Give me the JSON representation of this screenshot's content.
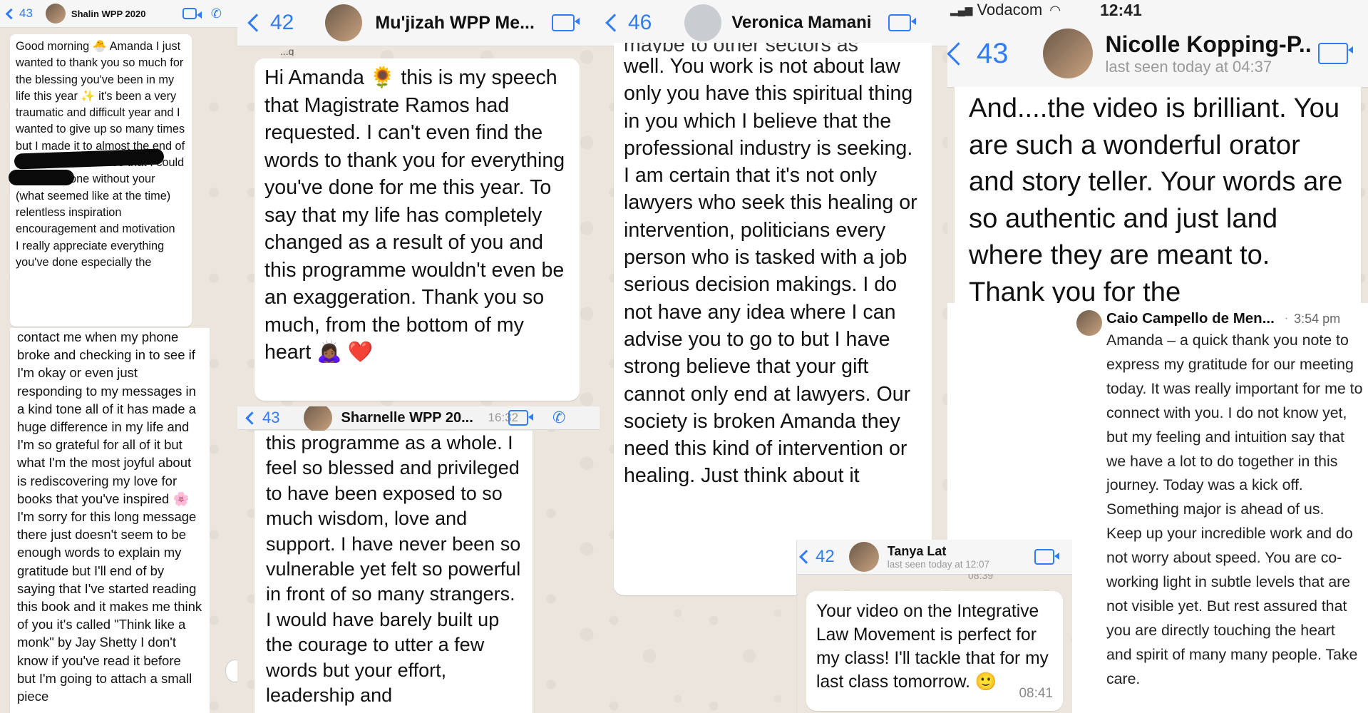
{
  "panel1": {
    "back_count": "43",
    "contact_name": "Shalin WPP 2020",
    "top_message": "Good morning 🐣 Amanda I just wanted to thank you so much for the blessing you've been in my life this year ✨ it's been a very traumatic and difficult year and I wanted to give up so many times\n                         but I made it to almost the end of the year and I realise that I could not have done without your (what seemed like at the time) relentless inspiration encouragement and motivation\nI really appreciate everything you've done especially the",
    "bottom_message": "contact me when my phone broke and checking in to see if I'm okay or even just responding to my messages in a kind tone all of it has made a huge difference in my life and I'm so grateful for all of it but what I'm the most joyful about is rediscovering my love for books that you've inspired 🌸 I'm sorry for this long message there just doesn't seem to be enough words to explain my gratitude but I'll end of by saying that I've started reading this book and it makes me think of you it's called \"Think like a monk\" by Jay Shetty I don't know if you've read it before but I'm going to attach a small piece"
  },
  "panel2": {
    "back_count": "42",
    "contact_name": "Mu'jizah WPP Me...",
    "top_fragment": "...g",
    "message": "Hi Amanda 🌻 this is my speech that Magistrate Ramos had requested. I can't even find the words to thank you for everything you've done for me this year. To say that my life has completely changed as a result of you and this programme wouldn't even be an exaggeration. Thank you so much, from the bottom of my heart 🙇🏾‍♀️ ❤️"
  },
  "panel3": {
    "back_count": "43",
    "contact_name": "Sharnelle WPP 20...",
    "time_fragment": "16:32",
    "message": "this programme as a whole. I feel so blessed and privileged to have been exposed to so much wisdom, love and support. I have never been so vulnerable yet felt so powerful in front of so many strangers. I would have barely built up the courage to utter a few words but your effort, leadership and"
  },
  "panel4": {
    "back_count": "46",
    "contact_name": "Veronica Mamani",
    "top_fragment": "maybe to other sectors as",
    "message": "well. You work is not about law only you have this spiritual thing in you which I believe that the professional industry is seeking.  I am certain that it's not only lawyers who seek this healing or intervention, politicians every person who is tasked with a job serious decision makings. I do not have any idea where I can advise you to go to but I have strong believe that your gift cannot only end at lawyers. Our society is broken Amanda they need this kind of intervention or healing. Just think about it"
  },
  "panel5": {
    "back_count": "42",
    "contact_name": "Tanya Lat",
    "last_seen": "last seen today at 12:07",
    "time_fragment": "08:39",
    "message": "Your video on the Integrative Law Movement is perfect for my class! I'll tackle that for my last class tomorrow. 🙂",
    "time": "08:41"
  },
  "panel6": {
    "carrier": "Vodacom",
    "clock": "12:41",
    "back_count": "43",
    "contact_name": "Nicolle Kopping-P...",
    "last_seen": "last seen today at 04:37",
    "message": "And....the video is brilliant. You are such a wonderful orator and story teller. Your words are so authentic and just land where they are meant to. Thank you for the"
  },
  "panel7": {
    "sender": "Caio Campello de Men...",
    "separator": "·",
    "time": "3:54 pm",
    "message": "Amanda – a quick thank you note to express my gratitude for our meeting today. It was really important for me to connect with you. I do not know yet, but my feeling and intuition say that we have a lot to do together in this journey. Today was a kick off. Something major is ahead of us. Keep up your incredible work and do not worry about speed. You are co-working light in subtle levels that are not visible yet. But rest assured that you are directly touching the heart and spirit of many many people. Take care."
  },
  "colors": {
    "ios_blue": "#2f7cf6",
    "chat_bg": "#ece5dd",
    "bubble": "#ffffff"
  },
  "icons": [
    "chevron-left-icon",
    "video-camera-icon",
    "phone-icon",
    "wifi-icon",
    "signal-icon",
    "battery-icon"
  ]
}
